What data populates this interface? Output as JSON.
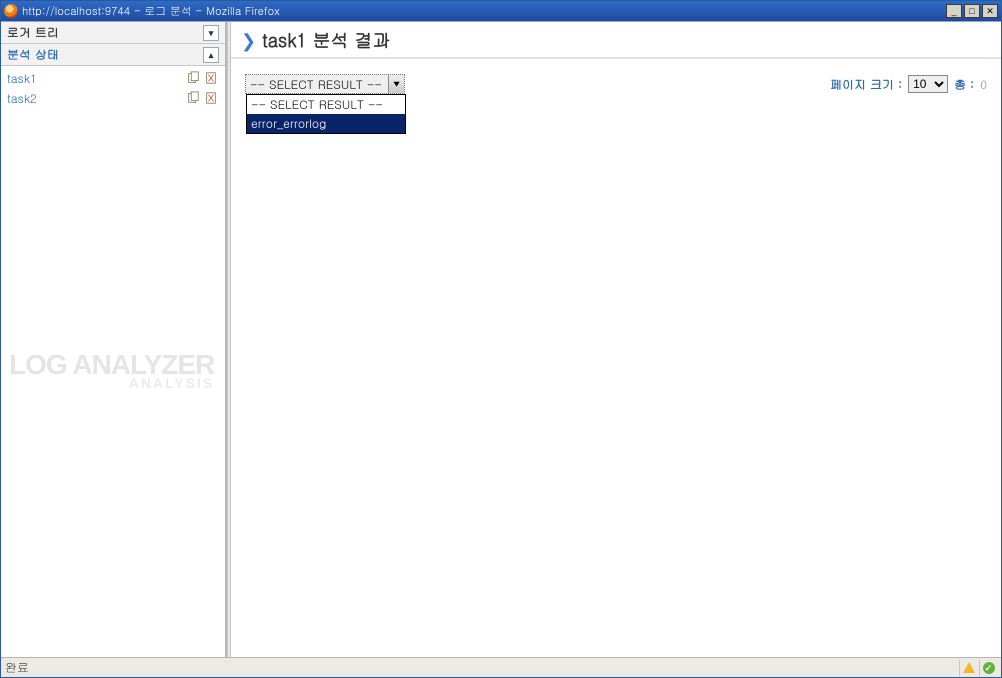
{
  "window": {
    "title": "http://localhost:9744 - 로그 분석 - Mozilla Firefox"
  },
  "sidebar": {
    "section1_label": "로거 트리",
    "section2_label": "분석 상태",
    "tasks": [
      {
        "label": "task1"
      },
      {
        "label": "task2"
      }
    ],
    "watermark_l1": "LOG ANALYZER",
    "watermark_l2": "ANALYSIS"
  },
  "main": {
    "title": "task1 분석 결과",
    "select_current": "-- SELECT RESULT --",
    "dropdown_options": [
      {
        "label": "-- SELECT RESULT --",
        "selected": false
      },
      {
        "label": "error_errorlog",
        "selected": true
      }
    ],
    "page_size_label": "페이지 크기 :",
    "page_size_value": "10",
    "total_label": "총 :",
    "total_value": "0"
  },
  "statusbar": {
    "text": "완료"
  }
}
